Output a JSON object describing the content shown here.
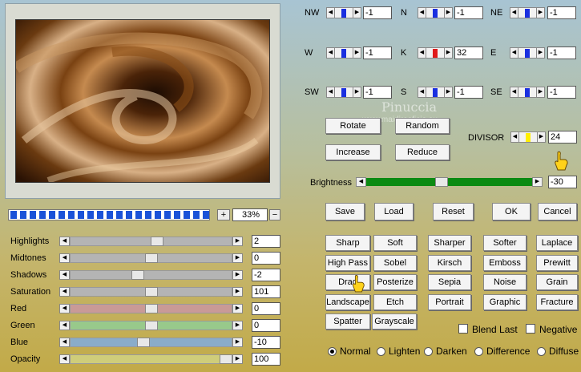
{
  "preview": {
    "zoom": "33%",
    "zoom_plus": "+",
    "zoom_minus": "−",
    "progress_segments": 21
  },
  "sliders": [
    {
      "label": "Highlights",
      "value": "2",
      "color": "#b4b4b4",
      "thumb": 0.54
    },
    {
      "label": "Midtones",
      "value": "0",
      "color": "#b4b4b4",
      "thumb": 0.5
    },
    {
      "label": "Shadows",
      "value": "-2",
      "color": "#b4b4b4",
      "thumb": 0.41
    },
    {
      "label": "Saturation",
      "value": "101",
      "color": "#b4b4b4",
      "thumb": 0.5
    },
    {
      "label": "Red",
      "value": "0",
      "color": "#c99a97",
      "thumb": 0.5
    },
    {
      "label": "Green",
      "value": "0",
      "color": "#98c98b",
      "thumb": 0.5
    },
    {
      "label": "Blue",
      "value": "-10",
      "color": "#8aacc9",
      "thumb": 0.45
    },
    {
      "label": "Opacity",
      "value": "100",
      "color": "#cfcd7a",
      "thumb": 1.0
    }
  ],
  "matrix": [
    {
      "label": "NW",
      "value": "-1",
      "color": "#1a2fe0"
    },
    {
      "label": "N",
      "value": "-1",
      "color": "#1a2fe0"
    },
    {
      "label": "NE",
      "value": "-1",
      "color": "#1a2fe0"
    },
    {
      "label": "W",
      "value": "-1",
      "color": "#1a2fe0"
    },
    {
      "label": "K",
      "value": "32",
      "color": "#e01a1a"
    },
    {
      "label": "E",
      "value": "-1",
      "color": "#1a2fe0"
    },
    {
      "label": "SW",
      "value": "-1",
      "color": "#1a2fe0"
    },
    {
      "label": "S",
      "value": "-1",
      "color": "#1a2fe0"
    },
    {
      "label": "SE",
      "value": "-1",
      "color": "#1a2fe0"
    }
  ],
  "watermark": {
    "name": "Pinuccia",
    "url": "www.maidireeficio.eu"
  },
  "controls": {
    "rotate": "Rotate",
    "random": "Random",
    "increase": "Increase",
    "reduce": "Reduce",
    "divisor_label": "DIVISOR",
    "divisor_value": "24",
    "divisor_color": "#ffef00",
    "brightness_label": "Brightness",
    "brightness_value": "-30",
    "brightness_color": "#0b8a12",
    "brightness_level": 0.45
  },
  "actions": {
    "save": "Save",
    "load": "Load",
    "reset": "Reset",
    "ok": "OK",
    "cancel": "Cancel"
  },
  "presets": [
    [
      "Sharp",
      "Soft",
      "Sharper",
      "Softer",
      "Laplace"
    ],
    [
      "High Pass",
      "Sobel",
      "Kirsch",
      "Emboss",
      "Prewitt"
    ],
    [
      "Drag",
      "Posterize",
      "Sepia",
      "Noise",
      "Grain"
    ],
    [
      "Landscape",
      "Etch",
      "Portrait",
      "Graphic",
      "Fracture"
    ],
    [
      "Spatter",
      "Grayscale"
    ]
  ],
  "checkboxes": {
    "blend_last": "Blend Last",
    "negative": "Negative"
  },
  "blend_modes": [
    {
      "label": "Normal",
      "selected": true
    },
    {
      "label": "Lighten",
      "selected": false
    },
    {
      "label": "Darken",
      "selected": false
    },
    {
      "label": "Difference",
      "selected": false
    },
    {
      "label": "Diffuse",
      "selected": false
    }
  ],
  "icons": {
    "hand_cursor": "pointing-hand-icon"
  }
}
